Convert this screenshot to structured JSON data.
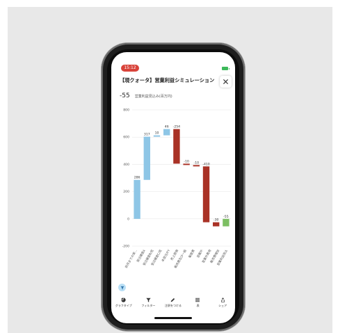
{
  "status": {
    "badge": "15:12"
  },
  "header": {
    "title": "【現クォータ】営業利益シミュレーション",
    "summary_value": "-55",
    "summary_label": "営業利益見込み(百万円)"
  },
  "colors": {
    "increase": "#8ec6e6",
    "decrease": "#a93226",
    "total": "#7dbf63",
    "grid": "#dddddd",
    "axis_text": "#555555",
    "badge": "#d9433a",
    "battery": "#3cb95a"
  },
  "chart_data": {
    "type": "bar",
    "subtype": "waterfall",
    "categories": [
      "前月までの実...",
      "受注確度A",
      "受注確度B/見",
      "受注確度C/見",
      "未受注/FY",
      "売上原価",
      "販売費及び一般",
      "販管費",
      "営業外",
      "営業外費用",
      "販売費増加",
      "営業利益見込"
    ],
    "values": [
      286,
      317,
      10,
      46,
      -254,
      -10,
      -10,
      -410,
      -30,
      -55
    ],
    "data_labels": [
      "286",
      "317",
      "10",
      "46",
      "-254",
      "-10",
      "-10",
      "-410",
      "-30",
      "-55"
    ],
    "starts": [
      0,
      286,
      603,
      613,
      659,
      405,
      395,
      385,
      -25,
      -55
    ],
    "ends": [
      286,
      603,
      613,
      659,
      405,
      395,
      385,
      -25,
      -55,
      0
    ],
    "kinds": [
      "increase",
      "increase",
      "increase",
      "increase",
      "decrease",
      "decrease",
      "decrease",
      "decrease",
      "decrease",
      "total"
    ],
    "yticks": [
      "800",
      "600",
      "400",
      "200",
      "0",
      "-200"
    ],
    "ylim": [
      -200,
      800
    ],
    "grid": true,
    "legend": "none"
  },
  "toolbar": {
    "items": [
      {
        "label": "グラフタイプ",
        "icon": "pie-chart-icon"
      },
      {
        "label": "フィルター",
        "icon": "filter-icon"
      },
      {
        "label": "注釈をつける",
        "icon": "pencil-icon"
      },
      {
        "label": "表",
        "icon": "table-icon"
      },
      {
        "label": "シェア",
        "icon": "share-icon"
      }
    ]
  }
}
